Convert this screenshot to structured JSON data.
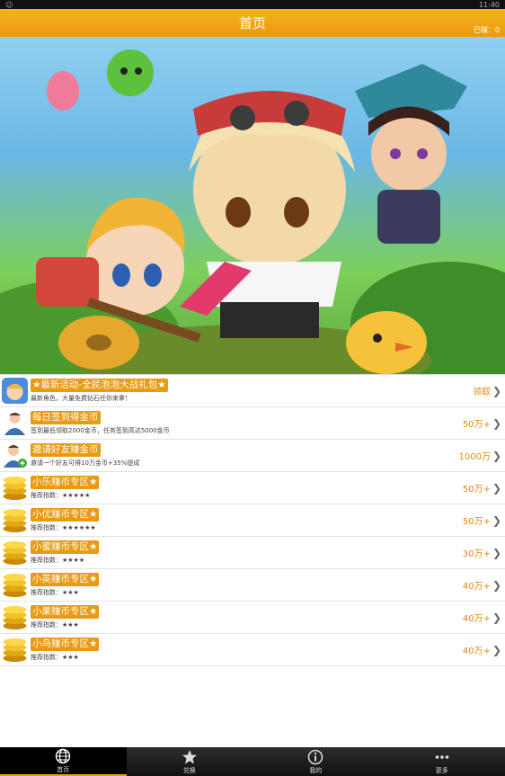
{
  "status_bar": {
    "time": "11:40"
  },
  "header": {
    "title": "首页",
    "earned": "已赚：0"
  },
  "banner": {
    "image": "game-characters-banner"
  },
  "list": [
    {
      "icon": "game-avatar-icon",
      "name": "★最新活动-全民泡泡大战礼包★",
      "desc": "最新角色，大量免费钻石任你来拿！",
      "reward": "领取"
    },
    {
      "icon": "user-icon",
      "name": "每日签到得金币",
      "desc": "签到最低领取2000金币，任务签到高达5000金币",
      "reward": "50万+"
    },
    {
      "icon": "user-add-icon",
      "name": "邀请好友赚金币",
      "desc": "邀请一个好友可得10万金币+35%提成",
      "reward": "1000万"
    },
    {
      "icon": "coins-icon",
      "name": "小乐赚币专区★",
      "desc": "推荐指数：★★★★★",
      "reward": "50万+"
    },
    {
      "icon": "coins-icon",
      "name": "小优赚币专区★",
      "desc": "推荐指数：★★★★★★",
      "reward": "50万+"
    },
    {
      "icon": "coins-icon",
      "name": "小蜜赚币专区★",
      "desc": "推荐指数：★★★★",
      "reward": "30万+"
    },
    {
      "icon": "coins-icon",
      "name": "小英赚币专区★",
      "desc": "推荐指数：★★★",
      "reward": "40万+"
    },
    {
      "icon": "coins-icon",
      "name": "小果赚币专区★",
      "desc": "推荐指数：★★★",
      "reward": "40万+"
    },
    {
      "icon": "coins-icon",
      "name": "小鸟赚币专区★",
      "desc": "推荐指数：★★★",
      "reward": "40万+"
    }
  ],
  "tabs": [
    {
      "label": "首页",
      "icon": "globe-icon",
      "active": true
    },
    {
      "label": "兑换",
      "icon": "star-icon",
      "active": false
    },
    {
      "label": "我的",
      "icon": "info-icon",
      "active": false
    },
    {
      "label": "更多",
      "icon": "more-icon",
      "active": false
    }
  ],
  "colors": {
    "accent": "#e99b0c",
    "reward": "#e4890c",
    "tabbar": "#1a1a1a"
  }
}
